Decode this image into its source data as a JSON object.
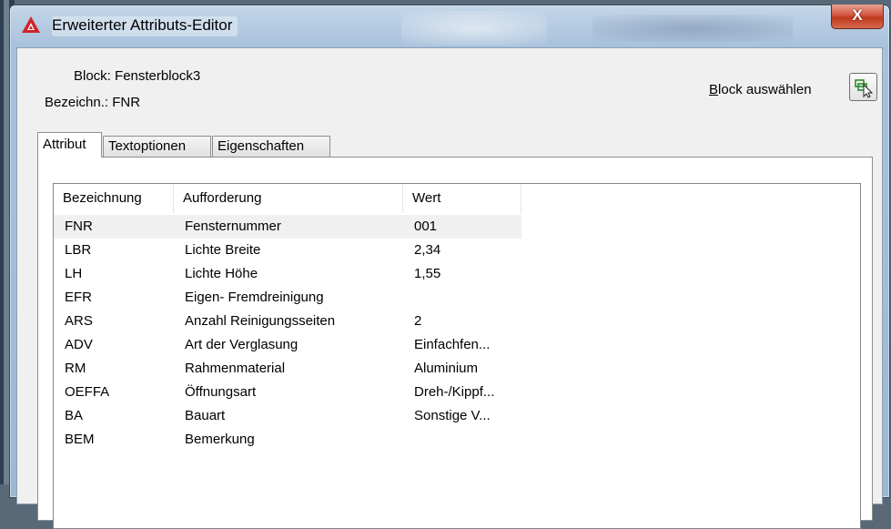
{
  "window": {
    "title": "Erweiterter Attributs-Editor",
    "close_label": "X"
  },
  "header": {
    "block_label": "Block:",
    "block_value": "Fensterblock3",
    "bez_label": "Bezeichn.:",
    "bez_value": "FNR",
    "select_block_label_hotkey": "B",
    "select_block_label_rest": "lock auswählen"
  },
  "tabs": [
    {
      "label": "Attribut"
    },
    {
      "label": "Textoptionen"
    },
    {
      "label": "Eigenschaften"
    }
  ],
  "table": {
    "columns": [
      "Bezeichnung",
      "Aufforderung",
      "Wert"
    ],
    "rows": [
      {
        "tag": "FNR",
        "prompt": "Fensternummer",
        "value": "001"
      },
      {
        "tag": "LBR",
        "prompt": "Lichte Breite",
        "value": "2,34"
      },
      {
        "tag": "LH",
        "prompt": "Lichte Höhe",
        "value": "1,55"
      },
      {
        "tag": "EFR",
        "prompt": "Eigen- Fremdreinigung",
        "value": ""
      },
      {
        "tag": "ARS",
        "prompt": "Anzahl Reinigungsseiten",
        "value": "2"
      },
      {
        "tag": "ADV",
        "prompt": "Art der Verglasung",
        "value": "Einfachfen..."
      },
      {
        "tag": "RM",
        "prompt": "Rahmenmaterial",
        "value": "Aluminium"
      },
      {
        "tag": "OEFFA",
        "prompt": "Öffnungsart",
        "value": "Dreh-/Kippf..."
      },
      {
        "tag": "BA",
        "prompt": "Bauart",
        "value": "Sonstige V..."
      },
      {
        "tag": "BEM",
        "prompt": "Bemerkung",
        "value": ""
      }
    ]
  },
  "icons": {
    "app": "autocad-a-icon",
    "select": "pick-cursor-icon"
  },
  "colors": {
    "close_button": "#c0391f",
    "app_icon": "#d0232a",
    "selected_row": "#f0f0f0"
  }
}
